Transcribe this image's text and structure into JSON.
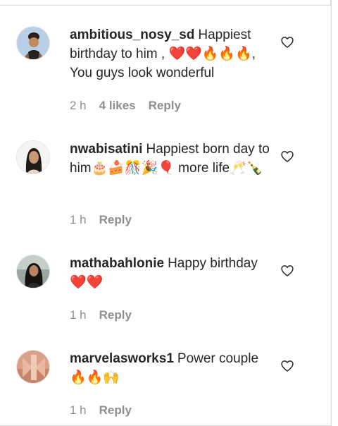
{
  "comments": [
    {
      "username": "ambitious_nosy_sd",
      "text": "Happiest birthday to him , ❤️❤️🔥🔥🔥, You guys look wonderful",
      "time": "2 h",
      "likes": "4 likes",
      "reply": "Reply"
    },
    {
      "username": "nwabisatini",
      "text": "Happiest born day to him🎂🍰🎊🎉🎈 more life🥂🍾",
      "time": "1 h",
      "reply": "Reply"
    },
    {
      "username": "mathabahlonie",
      "text": "Happy birthday ❤️❤️",
      "time": "1 h",
      "reply": "Reply"
    },
    {
      "username": "marvelasworks1",
      "text": "Power couple 🔥🔥🙌",
      "time": "1 h",
      "reply": "Reply"
    }
  ],
  "icons": {
    "like": "heart-outline-icon"
  }
}
